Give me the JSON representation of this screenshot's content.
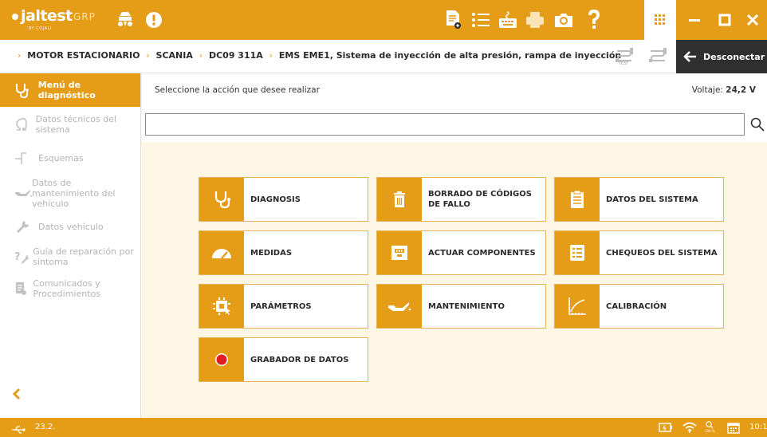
{
  "app": {
    "brand": "jaltest",
    "brand_sub": "BY COJALI",
    "brand_mode": "GRP"
  },
  "colors": {
    "accent": "#e59c17",
    "dark": "#2f2f2f",
    "content_bg": "#fdf6e4"
  },
  "top_icons": [
    "vehicle-icon",
    "warning-icon",
    "report-icon",
    "list-icon",
    "keyboard-icon",
    "print-icon",
    "camera-icon",
    "help-icon",
    "apps-grid-icon",
    "minimize-icon",
    "maximize-icon",
    "close-icon"
  ],
  "breadcrumb": {
    "items": [
      "MOTOR ESTACIONARIO",
      "SCANIA",
      "DC09 311A",
      "EMS EME1, Sistema de inyección de alta presión, rampa de inyección"
    ],
    "test_label": "TEST",
    "disconnect_label": "Desconectar"
  },
  "sidebar": {
    "items": [
      {
        "label": "Menú de diagnóstico",
        "icon": "stethoscope-icon",
        "active": true
      },
      {
        "label": "Datos técnicos del sistema",
        "icon": "omega-icon",
        "active": false
      },
      {
        "label": "Esquemas",
        "icon": "schematic-icon",
        "active": false
      },
      {
        "label": "Datos de mantenimiento del vehículo",
        "icon": "oil-can-icon",
        "active": false
      },
      {
        "label": "Datos vehículo",
        "icon": "wrench-icon",
        "active": false
      },
      {
        "label": "Guía de reparación por síntoma",
        "icon": "repair-guide-icon",
        "active": false
      },
      {
        "label": "Comunicados y Procedimientos",
        "icon": "documents-icon",
        "active": false
      }
    ]
  },
  "main": {
    "prompt": "Seleccione la acción que desee realizar",
    "voltage_label": "Voltaje:",
    "voltage_value": "24,2 V",
    "search_value": "",
    "search_placeholder": ""
  },
  "tiles": [
    {
      "label": "DIAGNOSIS",
      "icon": "stethoscope-icon"
    },
    {
      "label": "BORRADO DE CÓDIGOS DE FALLO",
      "icon": "trash-icon"
    },
    {
      "label": "DATOS DEL SISTEMA",
      "icon": "clipboard-icon"
    },
    {
      "label": "MEDIDAS",
      "icon": "gauge-icon"
    },
    {
      "label": "ACTUAR COMPONENTES",
      "icon": "connector-icon"
    },
    {
      "label": "CHEQUEOS DEL SISTEMA",
      "icon": "checklist-icon"
    },
    {
      "label": "PARÁMETROS",
      "icon": "chip-icon"
    },
    {
      "label": "MANTENIMIENTO",
      "icon": "oil-can-icon"
    },
    {
      "label": "CALIBRACIÓN",
      "icon": "calibration-curve-icon"
    },
    {
      "label": "GRABADOR DE DATOS",
      "icon": "record-icon"
    }
  ],
  "statusbar": {
    "version": "23.2.",
    "zoom": "100 %",
    "clock": "10:1"
  }
}
